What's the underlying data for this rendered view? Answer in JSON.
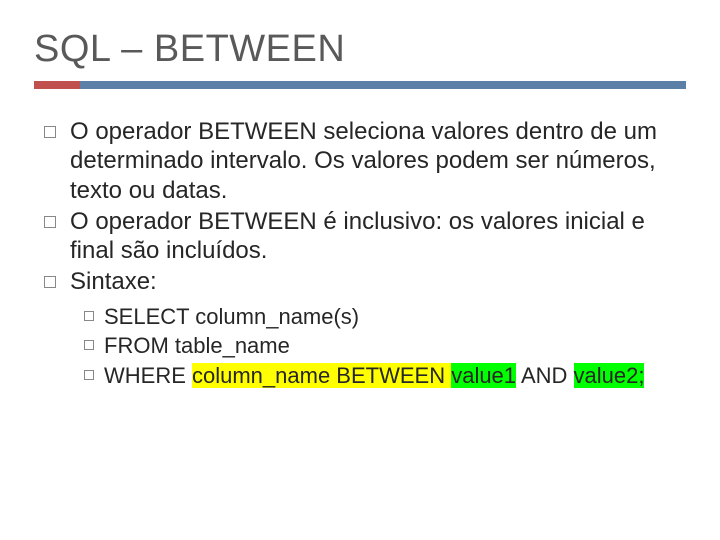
{
  "title": "SQL – BETWEEN",
  "bullets": [
    {
      "text": "O operador BETWEEN seleciona valores dentro de um determinado intervalo. Os valores podem ser números, texto ou datas."
    },
    {
      "text": "O operador BETWEEN é inclusivo: os valores inicial e final são incluídos."
    },
    {
      "text": "Sintaxe:"
    }
  ],
  "syntax": {
    "line1": "SELECT column_name(s)",
    "line2": "FROM table_name",
    "line3_pre": "WHERE ",
    "line3_col": "column_name",
    "line3_between": " BETWEEN ",
    "line3_val1": "value1",
    "line3_and": " AND ",
    "line3_val2": "value2;"
  }
}
